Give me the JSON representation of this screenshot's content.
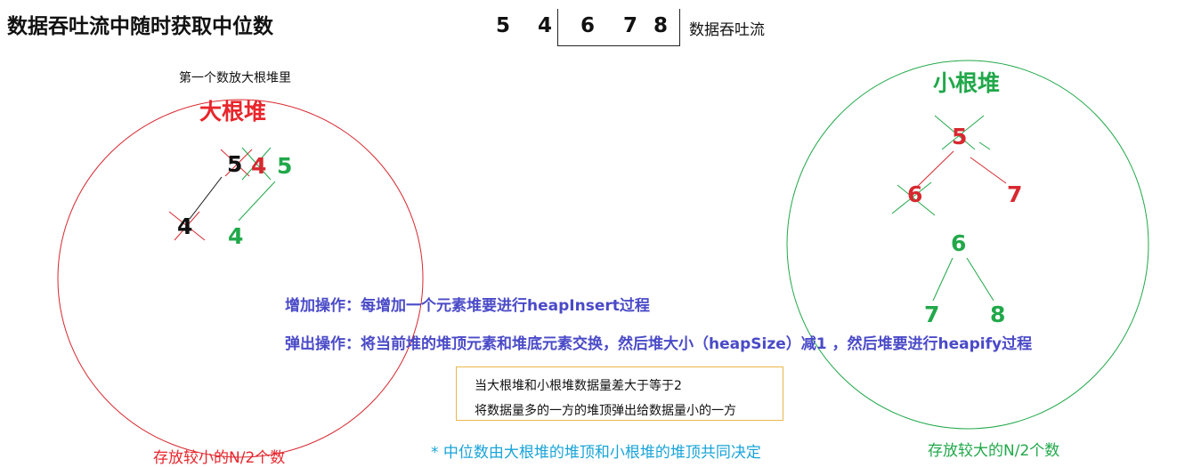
{
  "title": "数据吞吐流中随时获取中位数",
  "stream": {
    "numbers": [
      "5",
      "4",
      "6",
      "7",
      "8"
    ],
    "label": "数据吞吐流"
  },
  "max_heap": {
    "title": "大根堆",
    "first_note": "第一个数放大根堆里",
    "caption": "存放较小的N/2个数",
    "nodes": {
      "top_black": "5",
      "top_red": "4",
      "top_green": "5",
      "child_black": "4",
      "child_green": "4"
    }
  },
  "min_heap": {
    "title": "小根堆",
    "caption": "存放较大的N/2个数",
    "nodes": {
      "old_root": "5",
      "old_left": "6",
      "old_right": "7",
      "root": "6",
      "left": "7",
      "right": "8"
    }
  },
  "operations": {
    "add": "增加操作：每增加一个元素堆要进行heapInsert过程",
    "pop": "弹出操作：将当前堆的堆顶元素和堆底元素交换，然后堆大小（heapSize）减1 ，然后堆要进行heapify过程"
  },
  "balance_note": {
    "line1": "当大根堆和小根堆数据量差大于等于2",
    "line2": "将数据量多的一方的堆顶弹出给数据量小的一方"
  },
  "median_note": "* 中位数由大根堆的堆顶和小根堆的堆顶共同决定",
  "colors": {
    "red": "#e8262c",
    "green": "#21a84a",
    "blue_text": "#4a4ac8",
    "cyan_text": "#19a4d8",
    "note_border": "#e8b84a"
  }
}
